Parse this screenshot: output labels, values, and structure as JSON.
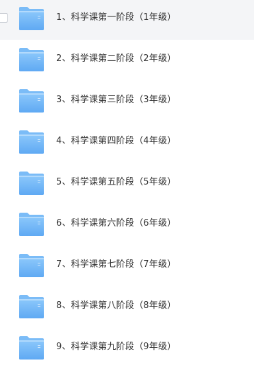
{
  "file_list": {
    "items": [
      {
        "name": "1、科学课第一阶段（1年级）",
        "icon": "folder-icon",
        "checkbox_visible": true,
        "highlighted": true
      },
      {
        "name": "2、科学课第二阶段（2年级）",
        "icon": "folder-icon",
        "checkbox_visible": false,
        "highlighted": false
      },
      {
        "name": "3、科学课第三阶段（3年级）",
        "icon": "folder-icon",
        "checkbox_visible": false,
        "highlighted": false
      },
      {
        "name": "4、科学课第四阶段（4年级）",
        "icon": "folder-icon",
        "checkbox_visible": false,
        "highlighted": false
      },
      {
        "name": "5、科学课第五阶段（5年级）",
        "icon": "folder-icon",
        "checkbox_visible": false,
        "highlighted": false
      },
      {
        "name": "6、科学课第六阶段（6年级）",
        "icon": "folder-icon",
        "checkbox_visible": false,
        "highlighted": false
      },
      {
        "name": "7、科学课第七阶段（7年级）",
        "icon": "folder-icon",
        "checkbox_visible": false,
        "highlighted": false
      },
      {
        "name": "8、科学课第八阶段（8年级）",
        "icon": "folder-icon",
        "checkbox_visible": false,
        "highlighted": false
      },
      {
        "name": "9、科学课第九阶段（9年级）",
        "icon": "folder-icon",
        "checkbox_visible": false,
        "highlighted": false
      }
    ]
  },
  "colors": {
    "folder_top": "#8cc8fb",
    "folder_bottom": "#5fa9f3",
    "folder_tab": "#7bbcf7",
    "row_highlight": "#f4f5f7",
    "text": "#333333"
  }
}
